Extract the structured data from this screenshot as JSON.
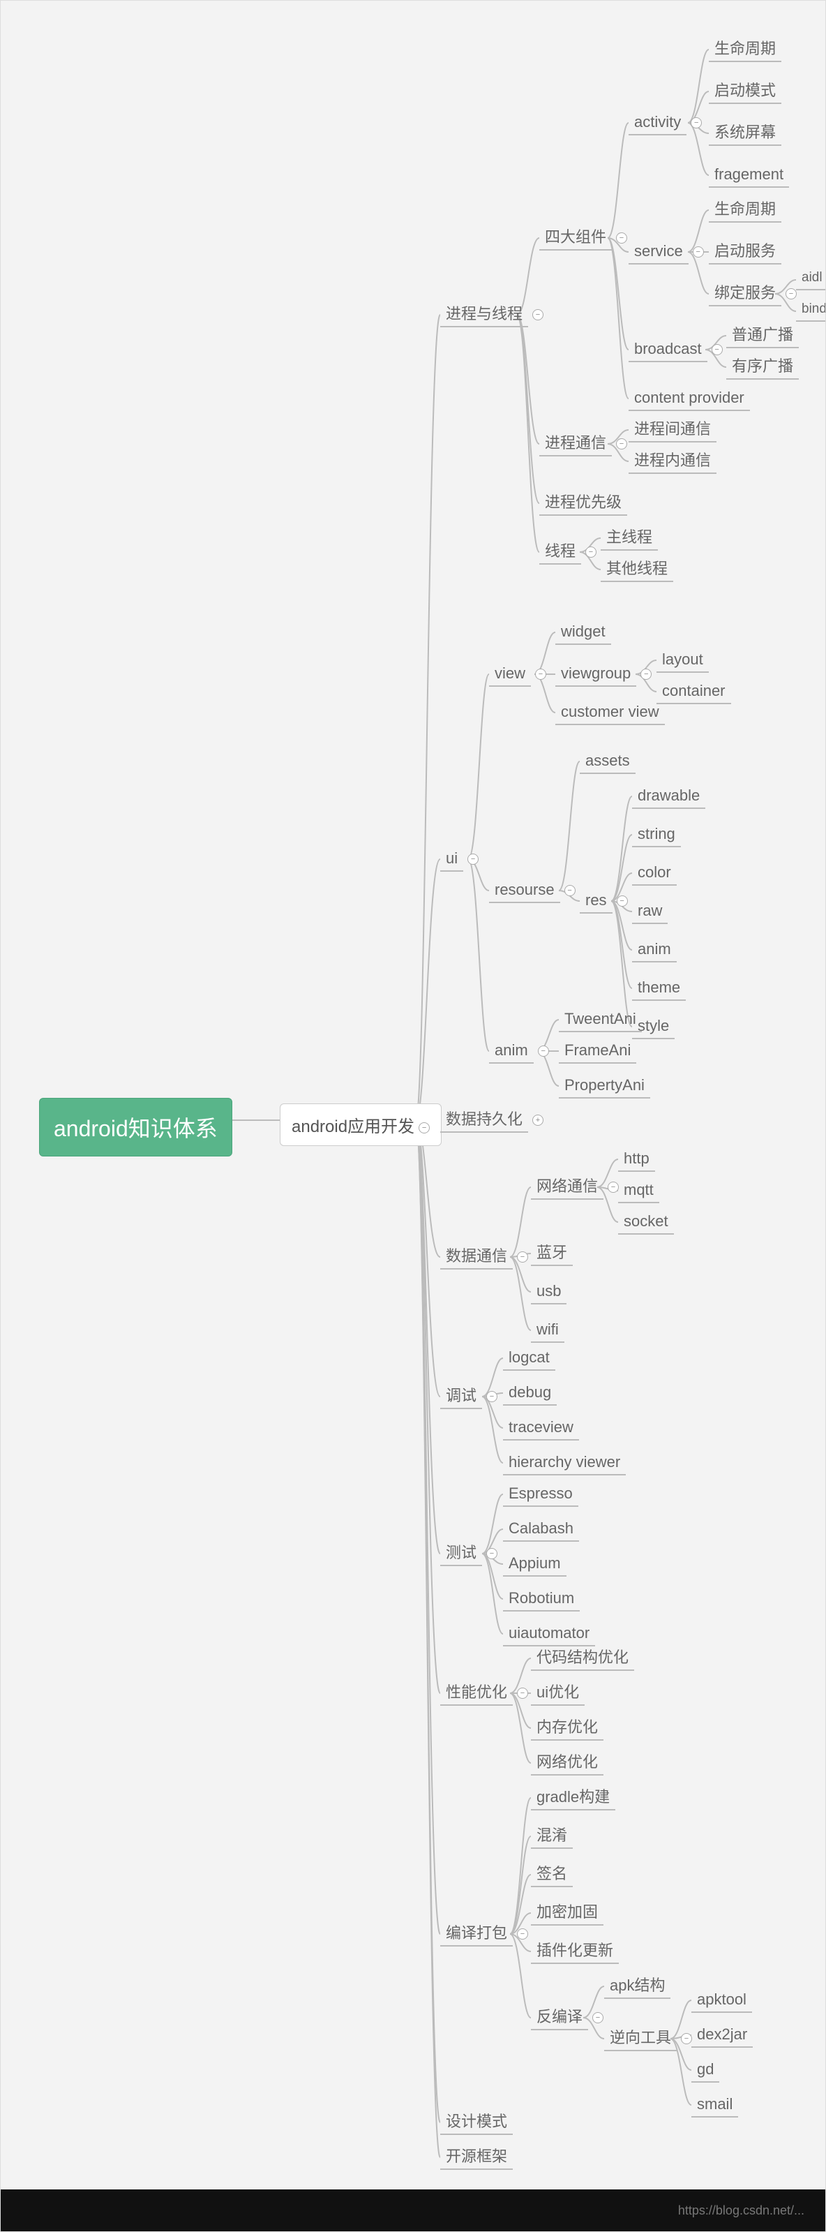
{
  "root": "android知识体系",
  "main": "android应用开发",
  "footer": "https://blog.csdn.net/...",
  "nodes": {
    "n_process": "进程与线程",
    "n_ui": "ui",
    "n_persist": "数据持久化",
    "n_datacomm": "数据通信",
    "n_debug": "调试",
    "n_test": "测试",
    "n_perf": "性能优化",
    "n_build": "编译打包",
    "n_pattern": "设计模式",
    "n_opensrc": "开源框架",
    "p_comp": "四大组件",
    "p_ipc": "进程通信",
    "p_prio": "进程优先级",
    "p_thread": "线程",
    "c_activity": "activity",
    "c_service": "service",
    "c_broadcast": "broadcast",
    "c_cp": "content provider",
    "a_life": "生命周期",
    "a_launch": "启动模式",
    "a_screen": "系统屏幕",
    "a_frag": "fragement",
    "s_life": "生命周期",
    "s_start": "启动服务",
    "s_bind": "绑定服务",
    "s_aidl": "aidl",
    "s_binder": "binder",
    "b_normal": "普通广播",
    "b_ordered": "有序广播",
    "ipc_inter": "进程间通信",
    "ipc_intra": "进程内通信",
    "t_main": "主线程",
    "t_other": "其他线程",
    "ui_view": "view",
    "ui_res": "resourse",
    "ui_anim": "anim",
    "v_widget": "widget",
    "v_vg": "viewgroup",
    "v_custom": "customer view",
    "vg_layout": "layout",
    "vg_container": "container",
    "r_assets": "assets",
    "r_res": "res",
    "res_drawable": "drawable",
    "res_string": "string",
    "res_color": "color",
    "res_raw": "raw",
    "res_anim": "anim",
    "res_theme": "theme",
    "res_style": "style",
    "anim_tween": "TweentAni",
    "anim_frame": "FrameAni",
    "anim_prop": "PropertyAni",
    "dc_net": "网络通信",
    "dc_bt": "蓝牙",
    "dc_usb": "usb",
    "dc_wifi": "wifi",
    "net_http": "http",
    "net_mqtt": "mqtt",
    "net_socket": "socket",
    "dbg_logcat": "logcat",
    "dbg_debug": "debug",
    "dbg_trace": "traceview",
    "dbg_hv": "hierarchy viewer",
    "tst_esp": "Espresso",
    "tst_cal": "Calabash",
    "tst_app": "Appium",
    "tst_rob": "Robotium",
    "tst_uia": "uiautomator",
    "pf_code": "代码结构优化",
    "pf_ui": "ui优化",
    "pf_mem": "内存优化",
    "pf_net": "网络优化",
    "bd_gradle": "gradle构建",
    "bd_prog": "混淆",
    "bd_sign": "签名",
    "bd_enc": "加密加固",
    "bd_plugin": "插件化更新",
    "bd_decomp": "反编译",
    "de_apk": "apk结构",
    "de_tools": "逆向工具",
    "tl_apktool": "apktool",
    "tl_dex2jar": "dex2jar",
    "tl_gd": "gd",
    "tl_smali": "smail"
  },
  "toggle_minus": "−",
  "toggle_plus": "+"
}
